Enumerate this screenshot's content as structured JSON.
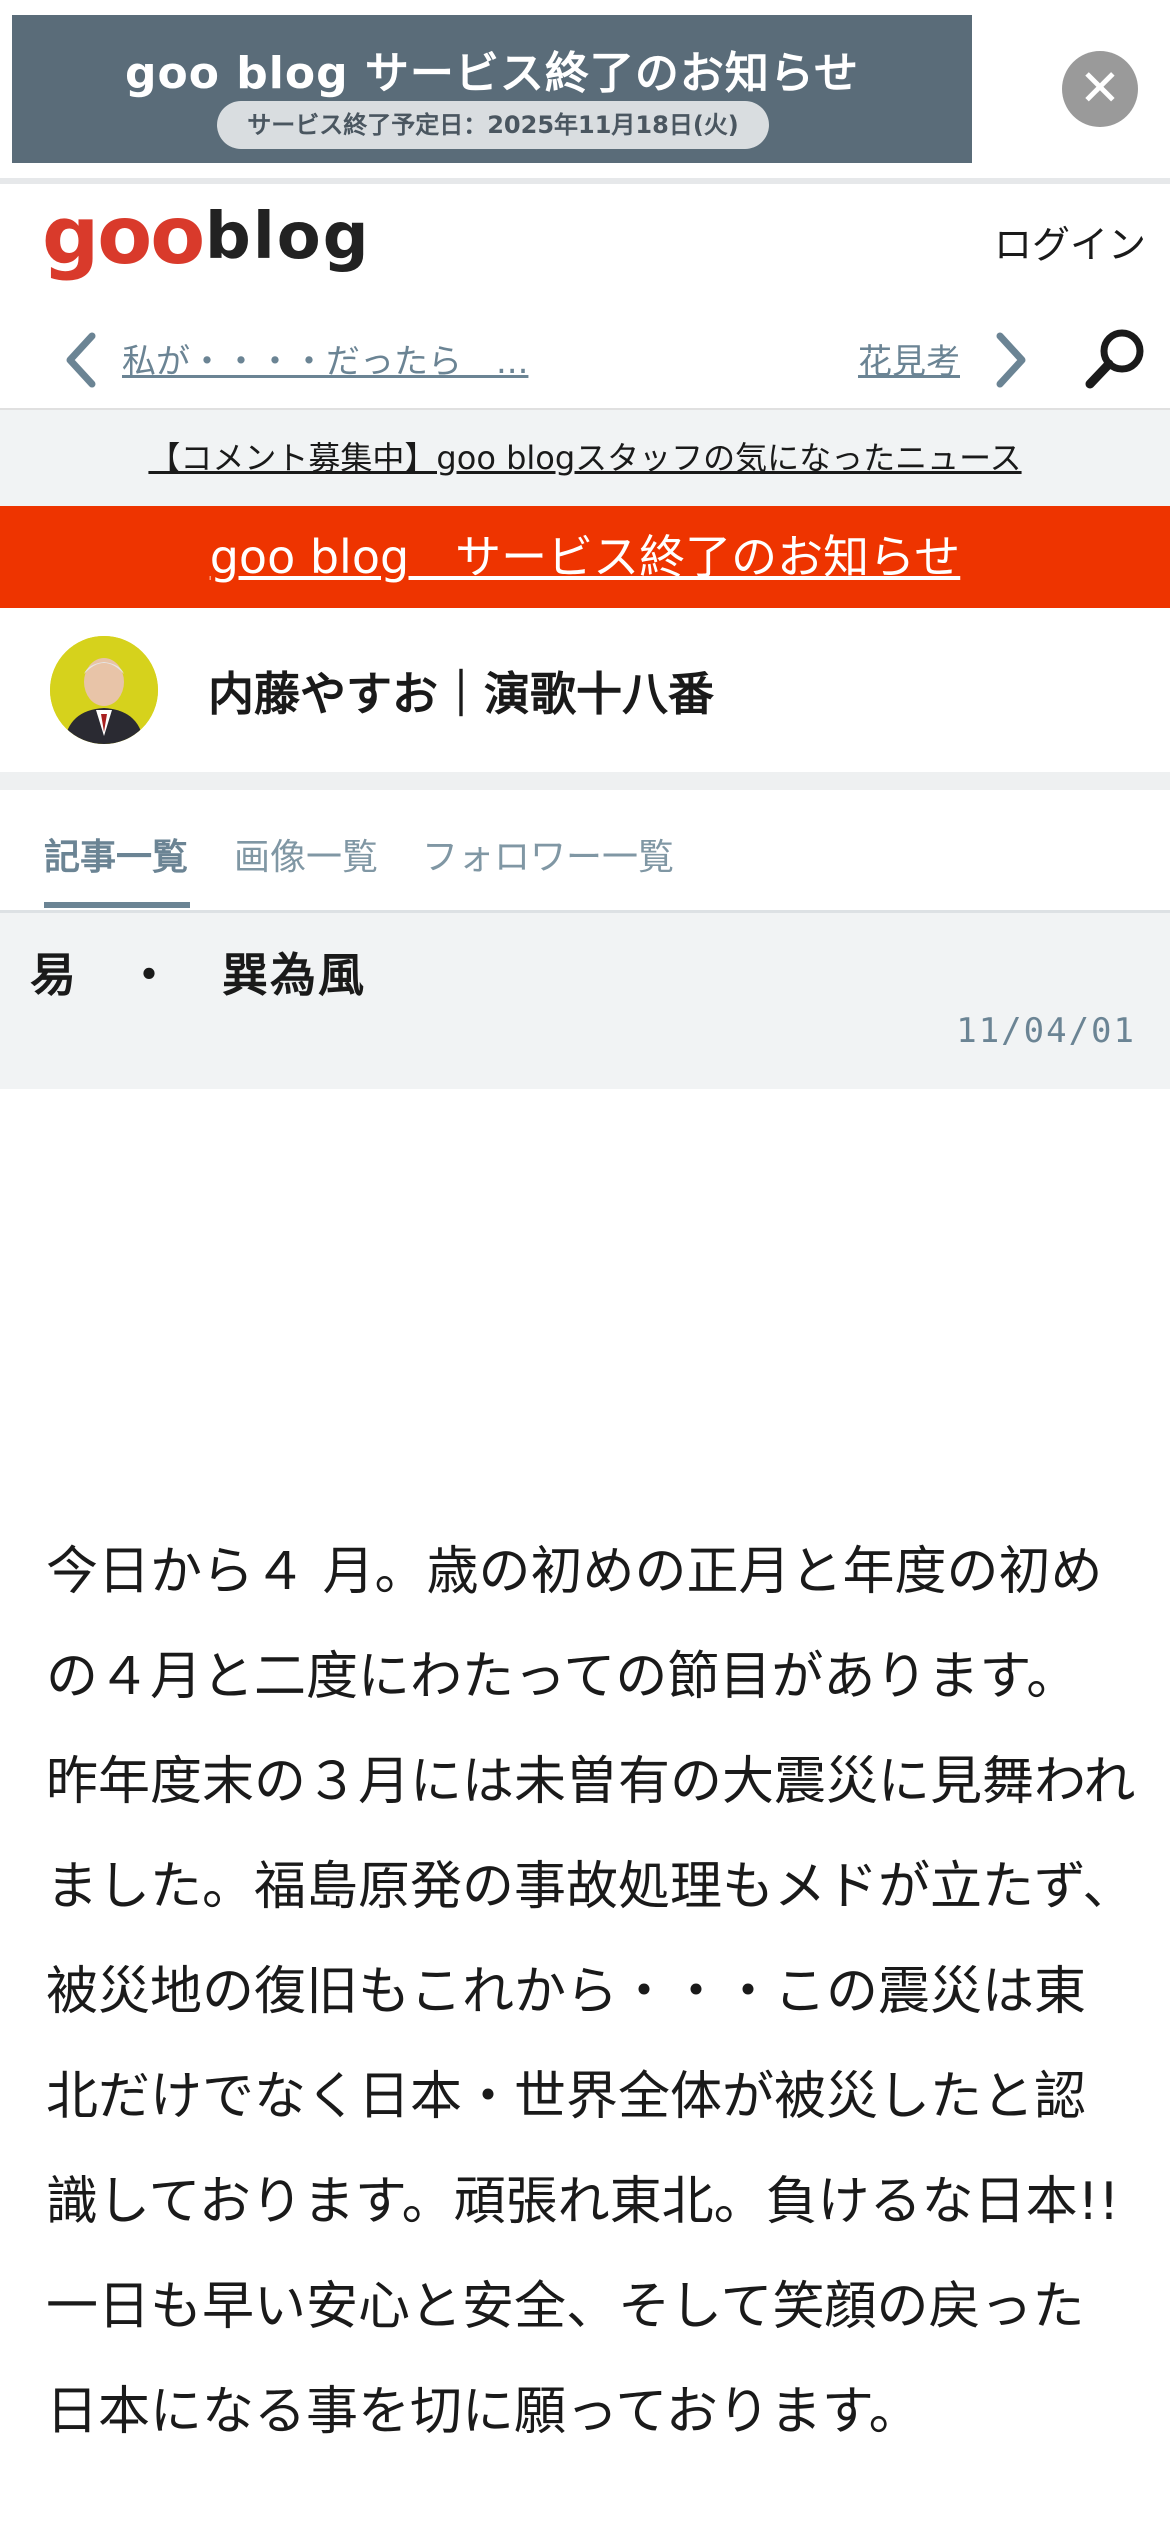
{
  "ad": {
    "title": "goo blog サービス終了のお知らせ",
    "date_pill": "サービス終了予定日：2025年11月18日(火)",
    "close_glyph": "✕"
  },
  "header": {
    "logo_goo": "goo",
    "logo_blog": "blog",
    "login_label": "ログイン",
    "brand_red": "#d93a2b"
  },
  "nav": {
    "prev_label": "私が・・・・だったら　...",
    "next_label": "花見考"
  },
  "news_link": "【コメント募集中】goo blogスタッフの気になったニュース",
  "notice": {
    "label": "goo blog　サービス終了のお知らせ",
    "color": "#ee3400"
  },
  "blog": {
    "title": "内藤やすお｜演歌十八番"
  },
  "tabs": [
    {
      "label": "記事一覧",
      "active": true
    },
    {
      "label": "画像一覧",
      "active": false
    },
    {
      "label": "フォロワー一覧",
      "active": false
    }
  ],
  "article": {
    "title": "易　・　巽為風",
    "date": "11/04/01",
    "paragraphs": [
      "今日から４ 月。歳の初めの正月と年度の初めの４月と二度にわたっての節目があります。",
      "昨年度末の３月には未曽有の大震災に見舞われました。福島原発の事故処理もメドが立たず、被災地の復旧もこれから・・・この震災は東北だけでなく日本・世界全体が被災したと認識しております。頑張れ東北。負けるな日本!! 一日も早い安心と安全、そして笑顔の戻った日本になる事を切に願っております。"
    ]
  }
}
